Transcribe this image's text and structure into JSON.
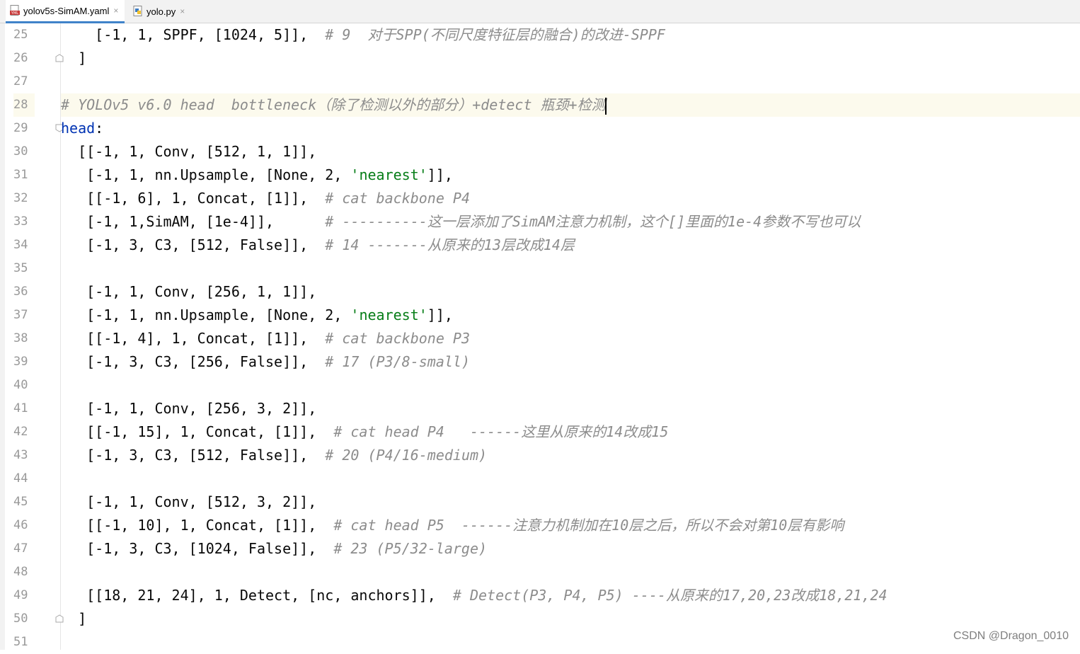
{
  "tabs": [
    {
      "label": "yolov5s-SimAM.yaml",
      "icon": "yaml-file-icon",
      "active": true
    },
    {
      "label": "yolo.py",
      "icon": "python-file-icon",
      "active": false
    }
  ],
  "close_glyph": "×",
  "line_numbers": [
    "25",
    "26",
    "27",
    "28",
    "29",
    "30",
    "31",
    "32",
    "33",
    "34",
    "35",
    "36",
    "37",
    "38",
    "39",
    "40",
    "41",
    "42",
    "43",
    "44",
    "45",
    "46",
    "47",
    "48",
    "49",
    "50",
    "51"
  ],
  "code": {
    "l25_code": "    [-1, 1, SPPF, [1024, 5]],  ",
    "l25_cmt": "# 9  对于SPP(不同尺度特征层的融合)的改进-SPPF",
    "l26_code": "  ]",
    "l28_cmt": "# YOLOv5 v6.0 head  bottleneck（除了检测以外的部分）+detect 瓶颈+检测",
    "l29_key": "head",
    "l29_colon": ":",
    "l30_code": "  [[-1, 1, Conv, [512, 1, 1]],",
    "l31_pre": "   [-1, 1, nn.Upsample, [None, 2, ",
    "l31_str": "'nearest'",
    "l31_post": "]],",
    "l32_code": "   [[-1, 6], 1, Concat, [1]],  ",
    "l32_cmt": "# cat backbone P4",
    "l33_code": "   [-1, 1,SimAM, [1e-4]],      ",
    "l33_cmt": "# ----------这一层添加了SimAM注意力机制，这个[]里面的1e-4参数不写也可以",
    "l34_code": "   [-1, 3, C3, [512, False]],  ",
    "l34_cmt": "# 14 -------从原来的13层改成14层",
    "l36_code": "   [-1, 1, Conv, [256, 1, 1]],",
    "l37_pre": "   [-1, 1, nn.Upsample, [None, 2, ",
    "l37_str": "'nearest'",
    "l37_post": "]],",
    "l38_code": "   [[-1, 4], 1, Concat, [1]],  ",
    "l38_cmt": "# cat backbone P3",
    "l39_code": "   [-1, 3, C3, [256, False]],  ",
    "l39_cmt": "# 17 (P3/8-small)",
    "l41_code": "   [-1, 1, Conv, [256, 3, 2]],",
    "l42_code": "   [[-1, 15], 1, Concat, [1]],  ",
    "l42_cmt": "# cat head P4   ------这里从原来的14改成15",
    "l43_code": "   [-1, 3, C3, [512, False]],  ",
    "l43_cmt": "# 20 (P4/16-medium)",
    "l45_code": "   [-1, 1, Conv, [512, 3, 2]],",
    "l46_code": "   [[-1, 10], 1, Concat, [1]],  ",
    "l46_cmt": "# cat head P5  ------注意力机制加在10层之后，所以不会对第10层有影响",
    "l47_code": "   [-1, 3, C3, [1024, False]],  ",
    "l47_cmt": "# 23 (P5/32-large)",
    "l49_code": "   [[18, 21, 24], 1, Detect, [nc, anchors]],  ",
    "l49_cmt": "# Detect(P3, P4, P5) ----从原来的17,20,23改成18,21,24",
    "l50_code": "  ]"
  },
  "watermark": "CSDN @Dragon_0010",
  "colors": {
    "comment": "#8c8c8c",
    "string": "#067d17",
    "keyword": "#0033b3",
    "current_line": "#fcfaed",
    "tab_underline": "#4083c9"
  }
}
